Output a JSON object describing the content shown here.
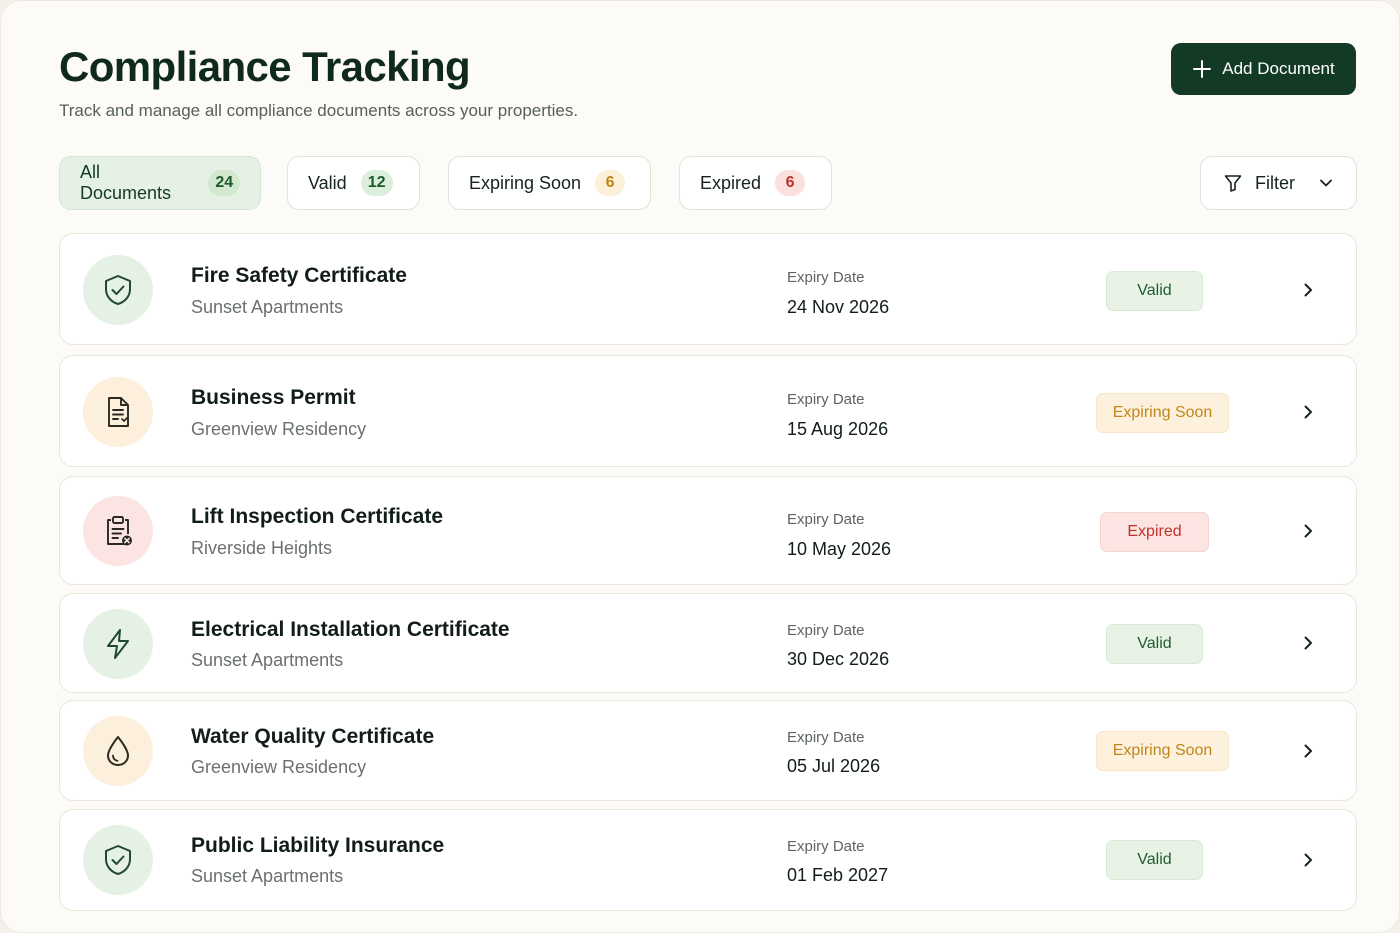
{
  "header": {
    "title": "Compliance Tracking",
    "subtitle": "Track and manage all compliance documents across your properties.",
    "add_button_label": "Add Document"
  },
  "tabs": [
    {
      "label": "All Documents",
      "count": "24",
      "active": true
    },
    {
      "label": "Valid",
      "count": "12",
      "active": false
    },
    {
      "label": "Expiring Soon",
      "count": "6",
      "active": false
    },
    {
      "label": "Expired",
      "count": "6",
      "active": false
    }
  ],
  "filter": {
    "label": "Filter"
  },
  "documents": [
    {
      "name": "Fire Safety Certificate",
      "property": "Sunset Apartments",
      "expiry_label": "Expiry Date",
      "expiry_date": "24 Nov 2026",
      "status": "Valid",
      "icon": "shield-check-icon"
    },
    {
      "name": "Business Permit",
      "property": "Greenview Residency",
      "expiry_label": "Expiry Date",
      "expiry_date": "15 Aug 2026",
      "status": "Expiring Soon",
      "icon": "document-icon"
    },
    {
      "name": "Lift Inspection Certificate",
      "property": "Riverside Heights",
      "expiry_label": "Expiry Date",
      "expiry_date": "10 May 2026",
      "status": "Expired",
      "icon": "clipboard-x-icon"
    },
    {
      "name": "Electrical Installation Certificate",
      "property": "Sunset Apartments",
      "expiry_label": "Expiry Date",
      "expiry_date": "30 Dec 2026",
      "status": "Valid",
      "icon": "lightning-icon"
    },
    {
      "name": "Water Quality Certificate",
      "property": "Greenview Residency",
      "expiry_label": "Expiry Date",
      "expiry_date": "05 Jul 2026",
      "status": "Expiring Soon",
      "icon": "water-drop-icon"
    },
    {
      "name": "Public Liability Insurance",
      "property": "Sunset Apartments",
      "expiry_label": "Expiry Date",
      "expiry_date": "01 Feb 2027",
      "status": "Valid",
      "icon": "shield-check-icon"
    }
  ],
  "colors": {
    "brand_dark_green": "#133a24",
    "valid_green": "#1d5e2e",
    "expiring_amber": "#c3851a",
    "expired_red": "#c0322a"
  }
}
